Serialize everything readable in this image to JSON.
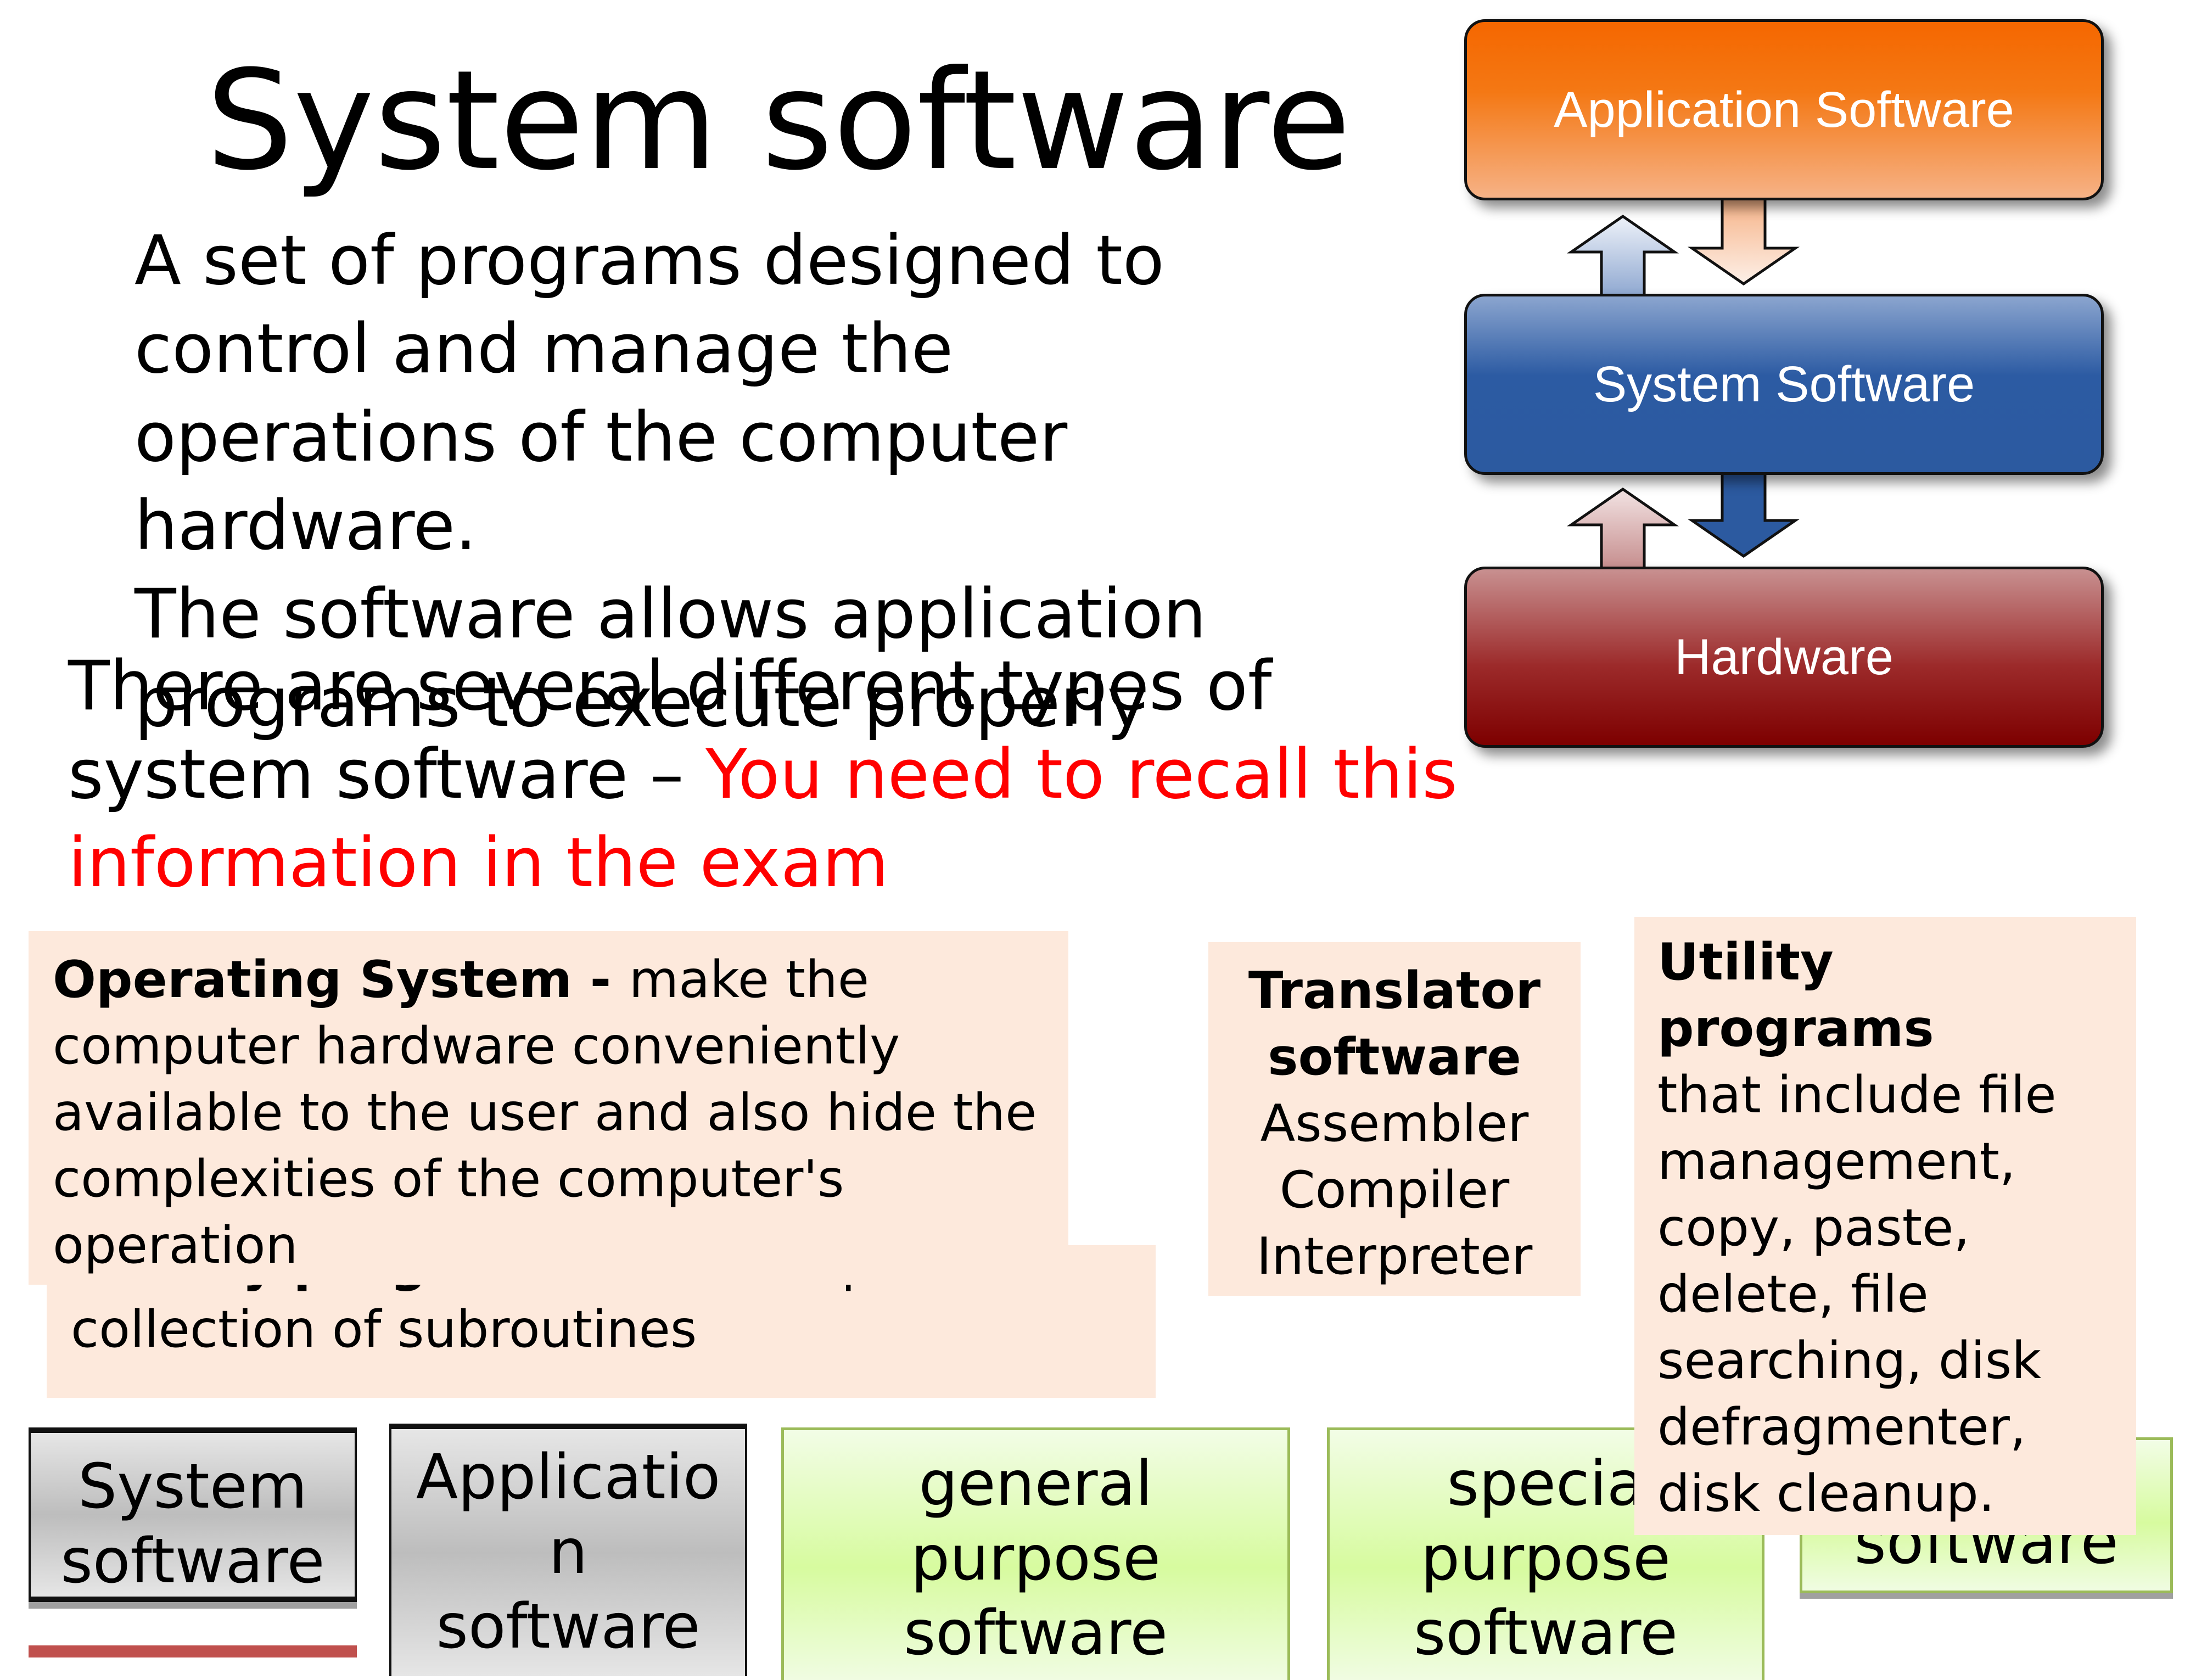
{
  "slide": {
    "title": "System software",
    "definition_lines": [
      "A set of programs designed to",
      "control and manage the",
      "operations of the computer",
      "hardware.",
      "The software allows application",
      "programs to execute properly"
    ],
    "types_intro": {
      "text_black": "There are several different types of system software – ",
      "text_red": "You need to recall this information in the exam"
    },
    "colors": {
      "highlight": "#ff0000",
      "note_bg": "#fde9dc",
      "green_border": "#9bbb59"
    }
  },
  "diagram": {
    "layers": [
      {
        "label": "Application Software",
        "color": "#f56700"
      },
      {
        "label": "System Software",
        "color": "#2c5aa0"
      },
      {
        "label": "Hardware",
        "color": "#7d0000"
      }
    ]
  },
  "notes": {
    "operating_system": {
      "title": "Operating System - ",
      "body": "make the computer hardware conveniently available to the user and also hide the complexities of the computer's operation"
    },
    "library": {
      "title": "Library programs",
      "body": " are a compiled collection of subroutines"
    },
    "translator": {
      "title": "Translator software",
      "items": [
        "Assembler",
        "Compiler",
        "Interpreter"
      ]
    },
    "utility": {
      "title": "Utility programs",
      "body": "that include file management, copy, paste, delete, file searching, disk defragmenter, disk cleanup."
    }
  },
  "bottom_boxes": {
    "system": "System software",
    "application": [
      "Applicatio",
      "n",
      "software"
    ],
    "general": [
      "general",
      "purpose",
      "software"
    ],
    "special": [
      "specia",
      "purpose",
      "software"
    ],
    "right": "software"
  }
}
